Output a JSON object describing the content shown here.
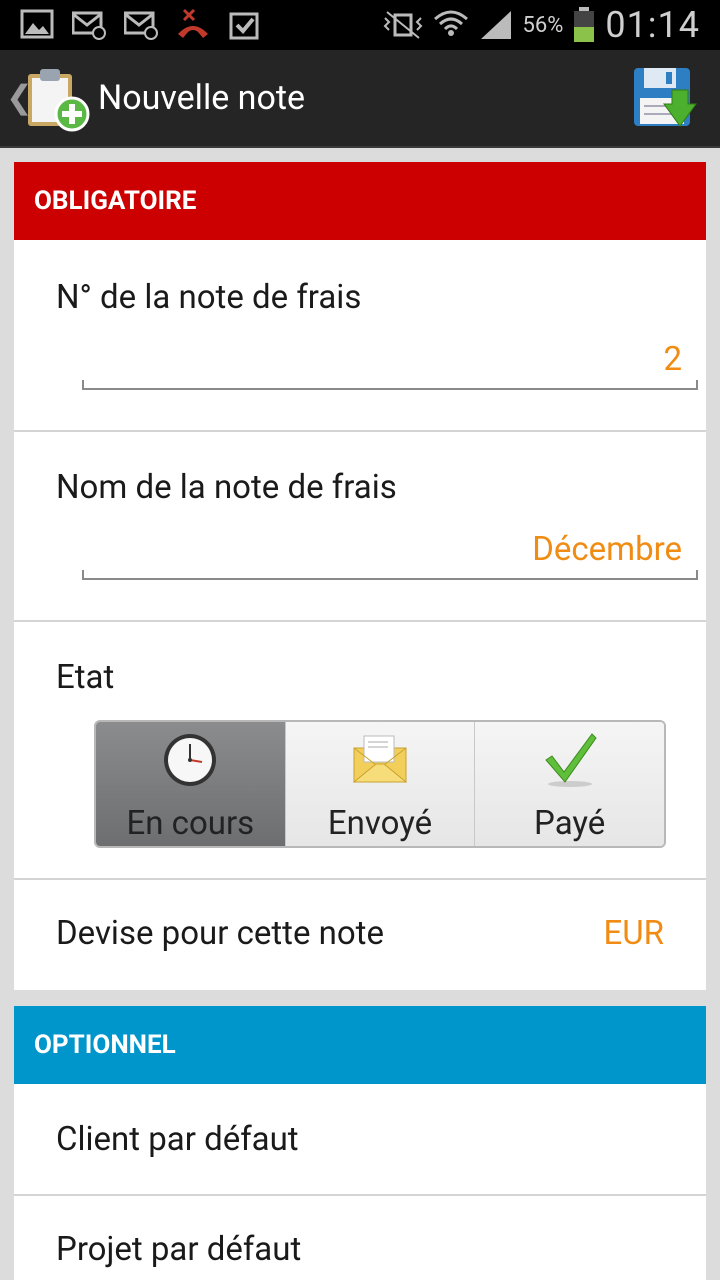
{
  "status_bar": {
    "battery_percent": "56%",
    "time": "01:14"
  },
  "action_bar": {
    "title": "Nouvelle note",
    "back_icon": "chevron-left-icon",
    "app_icon": "clipboard-add-icon",
    "save_icon": "floppy-save-icon"
  },
  "required_section": {
    "header": "OBLIGATOIRE",
    "color": "#cc0000",
    "fields": {
      "note_number": {
        "label": "N° de la note de frais",
        "value": "2"
      },
      "note_name": {
        "label": "Nom de la note de frais",
        "value": "Décembre"
      },
      "state": {
        "label": "Etat",
        "options": [
          {
            "label": "En cours",
            "icon": "clock-icon",
            "selected": true
          },
          {
            "label": "Envoyé",
            "icon": "envelope-icon",
            "selected": false
          },
          {
            "label": "Payé",
            "icon": "checkmark-icon",
            "selected": false
          }
        ]
      },
      "currency": {
        "label": "Devise pour cette note",
        "value": "EUR"
      }
    }
  },
  "optional_section": {
    "header": "OPTIONNEL",
    "color": "#0096cc",
    "fields": {
      "default_client": {
        "label": "Client par défaut"
      },
      "default_project": {
        "label": "Projet par défaut"
      }
    }
  },
  "accent_color": "#f08c14"
}
